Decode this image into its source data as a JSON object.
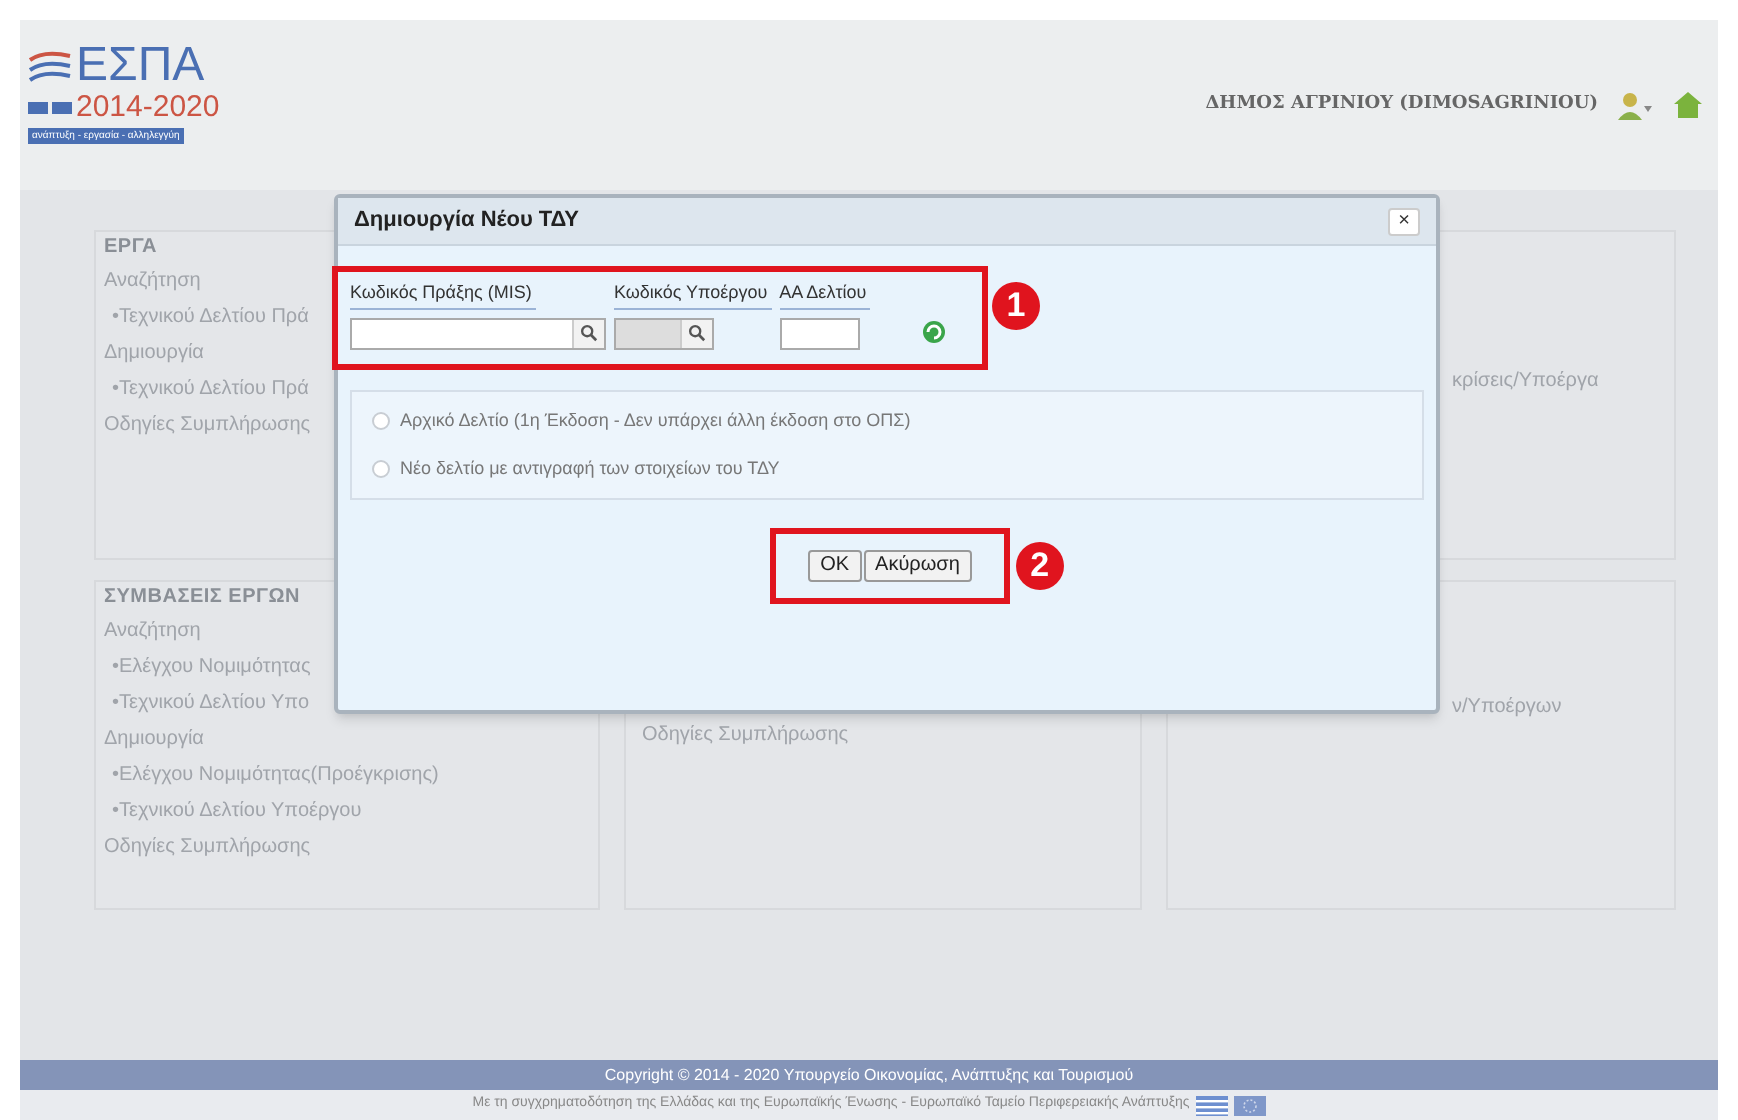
{
  "header": {
    "logo": {
      "title": "ΕΣΠΑ",
      "years": "2014-2020",
      "tagline": "ανάπτυξη - εργασία - αλληλεγγύη"
    },
    "user": "ΔΗΜΟΣ ΑΓΡΙΝΙΟΥ (DIMOSAGRINIOU)"
  },
  "cards": [
    {
      "lines": [
        {
          "kind": "heading",
          "text": "ΕΡΓΑ"
        },
        {
          "kind": "group",
          "text": "Αναζήτηση"
        },
        {
          "kind": "item",
          "text": "•Τεχνικού Δελτίου Πρά"
        },
        {
          "kind": "group",
          "text": "Δημιουργία"
        },
        {
          "kind": "item",
          "text": "•Τεχνικού Δελτίου Πρά"
        },
        {
          "kind": "group",
          "text": "Οδηγίες Συμπλήρωσης"
        }
      ]
    },
    {
      "lines": [
        {
          "kind": "item",
          "text": "κρίσεις/Υποέργα"
        }
      ]
    },
    {
      "lines": [
        {
          "kind": "heading",
          "text": "ΣΥΜΒΑΣΕΙΣ ΕΡΓΩΝ"
        },
        {
          "kind": "group",
          "text": "Αναζήτηση"
        },
        {
          "kind": "item",
          "text": "•Ελέγχου Νομιμότητας"
        },
        {
          "kind": "item",
          "text": "•Τεχνικού Δελτίου Υπο"
        },
        {
          "kind": "group",
          "text": "Δημιουργία"
        },
        {
          "kind": "item",
          "text": "•Ελέγχου Νομιμότητας(Προέγκρισης)"
        },
        {
          "kind": "item",
          "text": "•Τεχνικού Δελτίου Υποέργου"
        },
        {
          "kind": "group",
          "text": "Οδηγίες Συμπλήρωσης"
        }
      ]
    },
    {
      "lines": [
        {
          "kind": "group",
          "text": "Οδηγίες Συμπλήρωσης"
        }
      ]
    },
    {
      "lines": [
        {
          "kind": "item",
          "text": "ν/Υποέργων"
        }
      ]
    }
  ],
  "dialog": {
    "title": "Δημιουργία Νέου ΤΔΥ",
    "close": "×",
    "fields": [
      {
        "label": "Κωδικός Πράξης (MIS)",
        "kind": "search",
        "disabled": false
      },
      {
        "label": "Κωδικός Υποέργου",
        "kind": "search",
        "disabled": true
      },
      {
        "label": "ΑΑ Δελτίου",
        "kind": "plain",
        "disabled": false
      }
    ],
    "callouts": [
      "1",
      "2"
    ],
    "options": [
      {
        "label": "Αρχικό Δελτίο (1η Έκδοση - Δεν υπάρχει άλλη έκδοση στο ΟΠΣ)",
        "selected": false
      },
      {
        "label": "Νέο δελτίο με αντιγραφή των στοιχείων του ΤΔΥ",
        "selected": false
      }
    ],
    "buttons": [
      "OK",
      "Ακύρωση"
    ]
  },
  "footer": {
    "copyright": "Copyright © 2014 - 2020 Υπουργείο Οικονομίας, Ανάπτυξης και Τουρισμού",
    "cofunding": "Με τη συγχρηματοδότηση της Ελλάδας και της Ευρωπαϊκής Ένωσης - Ευρωπαϊκό Ταμείο Περιφερειακής Ανάπτυξης"
  }
}
